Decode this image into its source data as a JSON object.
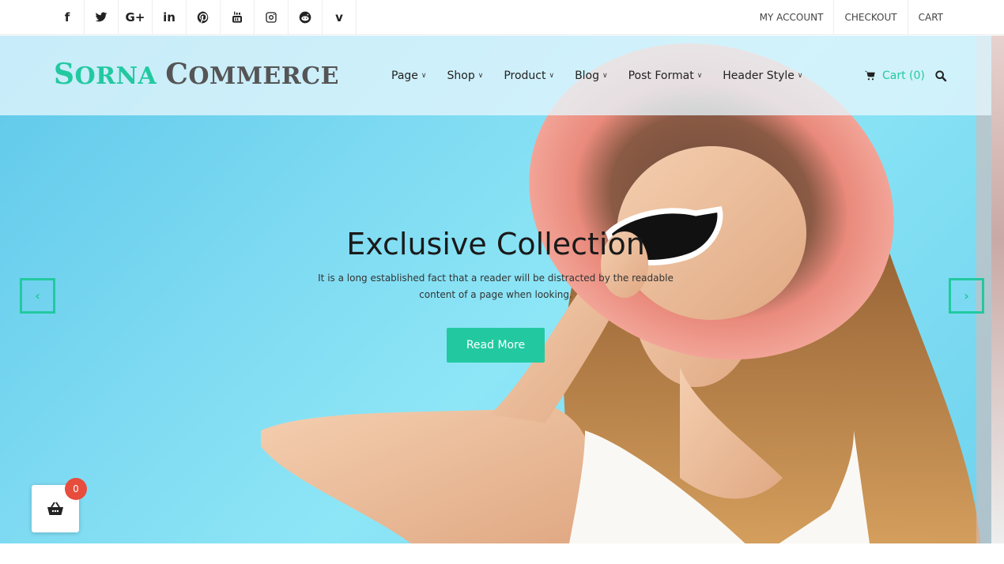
{
  "topbar": {
    "social_icons": [
      {
        "icon": "facebook-icon",
        "label": "f"
      },
      {
        "icon": "twitter-icon"
      },
      {
        "icon": "google-plus-icon",
        "label": "G+"
      },
      {
        "icon": "linkedin-icon",
        "label": "in"
      },
      {
        "icon": "pinterest-icon"
      },
      {
        "icon": "youtube-icon"
      },
      {
        "icon": "instagram-icon"
      },
      {
        "icon": "reddit-icon"
      },
      {
        "icon": "vimeo-icon",
        "label": "v"
      }
    ],
    "account_links": [
      "MY ACCOUNT",
      "CHECKOUT",
      "CART"
    ]
  },
  "header": {
    "logo": {
      "part1_first": "S",
      "part1_rest": "ORNA",
      "part2_first": "C",
      "part2_rest": "OMMERCE"
    },
    "nav": [
      "Page",
      "Shop",
      "Product",
      "Blog",
      "Post Format",
      "Header Style"
    ],
    "cart_label": "Cart (0)"
  },
  "slide": {
    "title": "Exclusive Collection",
    "text": "It is a long established fact that a reader will be distracted by the readable content of a page when looking.",
    "button": "Read More",
    "prev": "‹",
    "next": "›"
  },
  "floating_cart": {
    "count": "0"
  },
  "colors": {
    "accent": "#22c9a0",
    "badge": "#e74c3c"
  }
}
